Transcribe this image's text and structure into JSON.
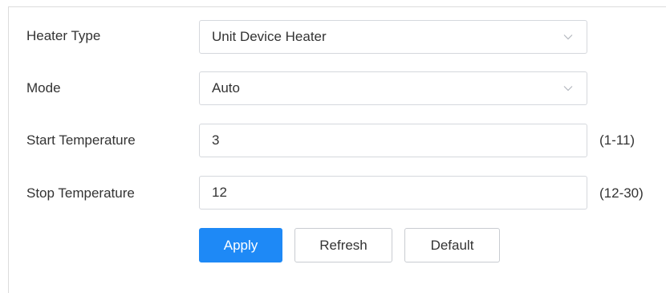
{
  "form": {
    "heater_type": {
      "label": "Heater Type",
      "value": "Unit Device Heater"
    },
    "mode": {
      "label": "Mode",
      "value": "Auto"
    },
    "start_temperature": {
      "label": "Start Temperature",
      "value": "3",
      "range": "(1-11)"
    },
    "stop_temperature": {
      "label": "Stop Temperature",
      "value": "12",
      "range": "(12-30)"
    }
  },
  "buttons": {
    "apply": "Apply",
    "refresh": "Refresh",
    "default": "Default"
  },
  "icons": {
    "dropdown": "chevron-down-icon"
  },
  "colors": {
    "primary": "#1e89f6",
    "border": "#d5d8dd"
  }
}
